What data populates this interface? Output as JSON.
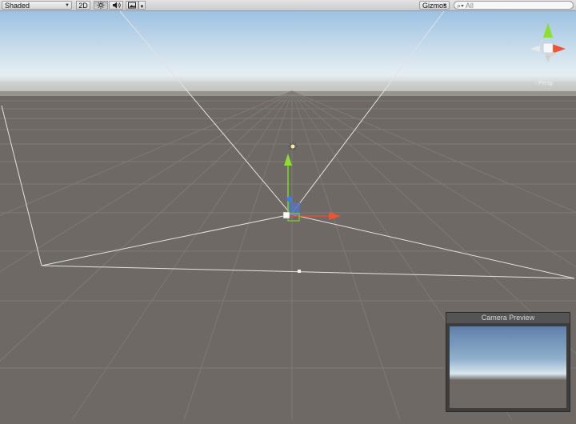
{
  "toolbar": {
    "shading_mode": "Shaded",
    "mode_2d_label": "2D",
    "gizmos_label": "Gizmos",
    "search_placeholder": "All",
    "icons": [
      "sun-icon",
      "audio-icon",
      "image-effects-icon",
      "dropdown-arrow-icon",
      "search-icon"
    ]
  },
  "scene": {
    "sky_color": "#9cc1e2",
    "horizon_color": "#e6eef3",
    "ground_color": "#6e6964",
    "grid_color": "#7e7a76",
    "icons": [
      "light-icon",
      "camera-icon",
      "scene-orientation-gizmo"
    ]
  },
  "camera_preview": {
    "title": "Camera Preview"
  }
}
